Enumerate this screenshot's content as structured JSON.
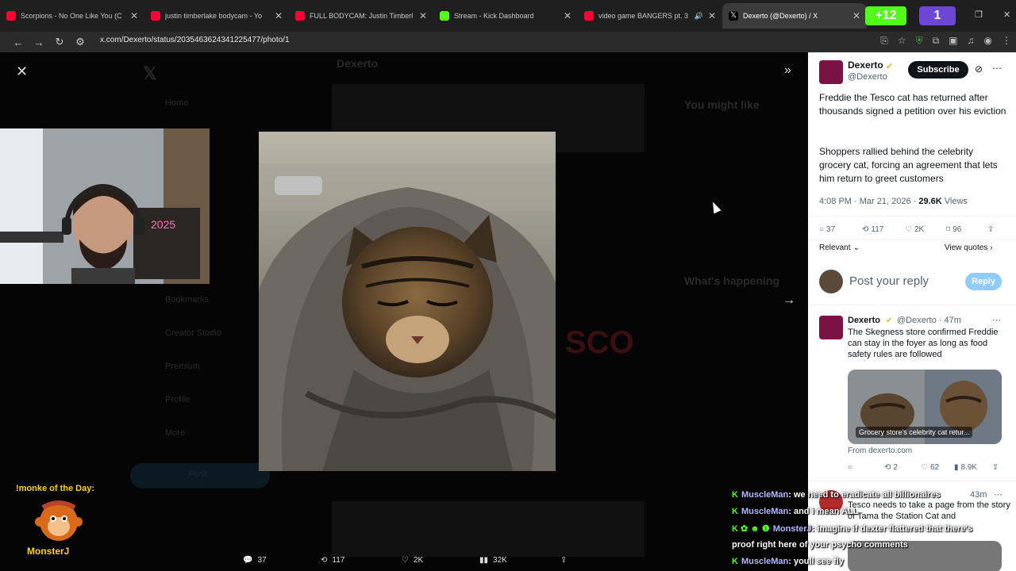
{
  "browser": {
    "tabs": [
      {
        "label": "Scorpions - No One Like You (C",
        "favicon": "youtube"
      },
      {
        "label": "justin timberlake bodycam - Yo",
        "favicon": "youtube"
      },
      {
        "label": "FULL BODYCAM: Justin Timberl",
        "favicon": "youtube"
      },
      {
        "label": "Stream - Kick Dashboard",
        "favicon": "kick"
      },
      {
        "label": "video game BANGERS pt. 3",
        "favicon": "youtube"
      },
      {
        "label": "Dexerto (@Dexerto) / X",
        "favicon": "x"
      }
    ],
    "ext_kick_count": "+12",
    "ext_twitch_count": "1",
    "url": "x.com/Dexerto/status/2035463624341225477/photo/1"
  },
  "viewer": {
    "actions": {
      "replies": "37",
      "reposts": "117",
      "likes": "2K",
      "views": "32K"
    }
  },
  "overlay": {
    "monke_title": "!monke of the Day:",
    "monke_name": "MonsterJ"
  },
  "background_page": {
    "author": "Dexerto",
    "you_might_like": "You might like",
    "whats_happening": "What's happening",
    "tesco_logo": "SCO",
    "nav": [
      "Home",
      "Explore",
      "Bookmarks",
      "Creator Studio",
      "Premium",
      "Profile",
      "More"
    ],
    "post_button": "Post"
  },
  "panel": {
    "author_name": "Dexerto",
    "author_handle": "@Dexerto",
    "subscribe_label": "Subscribe",
    "post_text_1": "Freddie the Tesco cat has returned after thousands signed a petition over his eviction",
    "post_text_2": "Shoppers rallied behind the celebrity grocery cat, forcing an agreement that lets him return to greet customers",
    "timestamp": "4:08 PM · Mar 21, 2026",
    "views_count": "29.6K",
    "views_label": "Views",
    "stats": {
      "replies": "37",
      "reposts": "117",
      "likes": "2K",
      "bookmarks": "96"
    },
    "sort_label": "Relevant",
    "view_quotes": "View quotes",
    "reply_placeholder": "Post your reply",
    "reply_button": "Reply",
    "reply1": {
      "name": "Dexerto",
      "handle": "@Dexerto · 47m",
      "text": "The Skegness store confirmed Freddie can stay in the foyer as long as food safety rules are followed",
      "card_caption": "Grocery store's celebrity cat retur...",
      "card_source": "From dexerto.com",
      "stats": {
        "replies": "",
        "reposts": "2",
        "likes": "62",
        "views": "8.9K"
      }
    },
    "reply2": {
      "time": "43m",
      "text": "Tesco needs to take a page from the story of Tama the Station Cat and"
    }
  },
  "chat": [
    {
      "user": "MuscleMan",
      "message": ": we need to eradicate all billionaires"
    },
    {
      "user": "MuscleMan",
      "message": ": and i mean ALL"
    },
    {
      "user": "MonsterJ",
      "message": ": imagine if dexter flattered that there's"
    },
    {
      "user": "",
      "message": "proof right here of your psycho comments"
    },
    {
      "user": "MuscleMan",
      "message": ": youll see fly"
    }
  ],
  "colors": {
    "kick_green": "#53fc18",
    "x_blue": "#1d9bf0",
    "twitch_purple": "#6c47d6",
    "verified_gold": "#e2b719"
  }
}
